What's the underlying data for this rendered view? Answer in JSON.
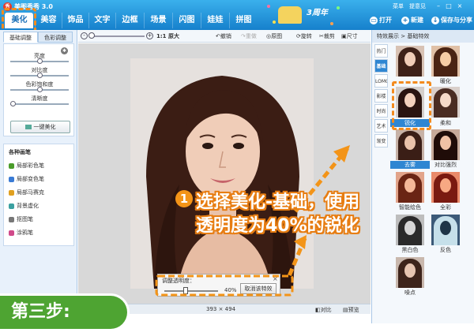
{
  "app": {
    "title": "美图秀秀 3.0",
    "logo": "秀"
  },
  "nav": {
    "tabs": [
      "美化",
      "美容",
      "饰品",
      "文字",
      "边框",
      "场景",
      "闪图",
      "娃娃",
      "拼图"
    ],
    "active": 0
  },
  "banner": {
    "text": "3周年"
  },
  "top_right": {
    "links": [
      "菜单",
      "提意见"
    ],
    "buttons": [
      {
        "icon": "folder-icon",
        "label": "打开"
      },
      {
        "icon": "plus-icon",
        "label": "新建"
      },
      {
        "icon": "save-icon",
        "label": "保存与分享"
      }
    ]
  },
  "left": {
    "tabs": [
      "基础调整",
      "色彩调整"
    ],
    "sliders": [
      {
        "label": "亮度",
        "value": 0.5
      },
      {
        "label": "对比度",
        "value": 0.5
      },
      {
        "label": "色彩饱和度",
        "value": 0.5
      },
      {
        "label": "清晰度",
        "value": 0.05
      }
    ],
    "one_click": "一键美化",
    "brush_title": "各种画笔",
    "brushes": [
      {
        "label": "局部彩色笔",
        "color": "#4a9c2a"
      },
      {
        "label": "局部变色笔",
        "color": "#3a7bd5"
      },
      {
        "label": "局部马赛克",
        "color": "#e0a020"
      },
      {
        "label": "背景虚化",
        "color": "#3aa0a0"
      },
      {
        "label": "抠图笔",
        "color": "#777777"
      },
      {
        "label": "涂鸦笔",
        "color": "#d04a8a"
      }
    ]
  },
  "toolbar": {
    "zoom_label": "1:1 原大",
    "tools": [
      {
        "label": "撤销",
        "enabled": true
      },
      {
        "label": "重做",
        "enabled": false
      },
      {
        "label": "原图",
        "enabled": true
      },
      {
        "label": "旋转",
        "enabled": true
      },
      {
        "label": "裁剪",
        "enabled": true
      },
      {
        "label": "尺寸",
        "enabled": true
      }
    ]
  },
  "opacity_panel": {
    "title": "调整透明度：",
    "value": "40%",
    "fraction": 0.4,
    "cancel": "取消该特效"
  },
  "status": {
    "size": "393 × 494",
    "compare": "对比",
    "preview": "预览"
  },
  "right": {
    "header": "特效展示 > 基础特效",
    "categories": [
      "热门",
      "基础",
      "LOMO",
      "影楼",
      "时尚",
      "艺术",
      "渐变"
    ],
    "active_category": 1,
    "effects": [
      "暖化",
      "锐化",
      "柔和",
      "去雾",
      "对比强烈",
      "智能绘色",
      "全彩",
      "黑白色",
      "反色",
      "噪点"
    ],
    "selected_effect": "锐化"
  },
  "overlay": {
    "badge": "1",
    "line1": "选择美化-基础，使用",
    "line2": "透明度为40%的锐化",
    "step": "第三步:"
  },
  "colors": {
    "accent": "#f39418",
    "blue": "#1a70b8",
    "green": "#4ea432"
  }
}
